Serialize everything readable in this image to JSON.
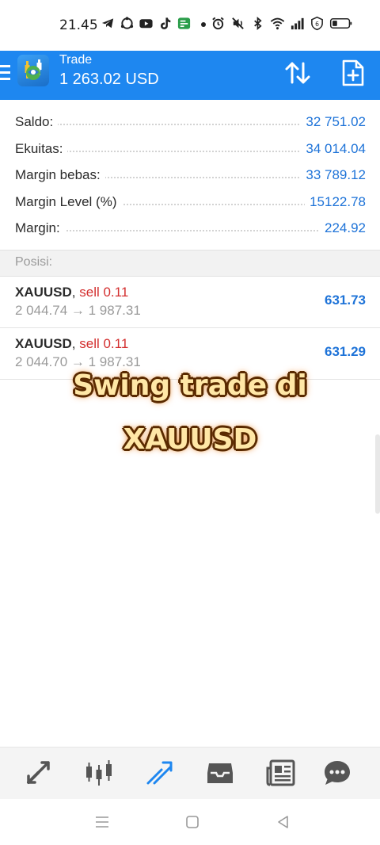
{
  "status_bar": {
    "time": "21.45",
    "left_icons": [
      "telegram-icon",
      "recycle-icon",
      "youtube-icon",
      "tiktok-icon",
      "chat-icon"
    ],
    "right_icons": [
      "alarm-icon",
      "mute-icon",
      "bluetooth-icon",
      "wifi-icon",
      "signal-icon",
      "data-saver-icon",
      "battery-icon"
    ]
  },
  "app_bar": {
    "title": "Trade",
    "balance": "1 263.02 USD",
    "color": "#1e87f0"
  },
  "summary": [
    {
      "label": "Saldo:",
      "value": "32 751.02"
    },
    {
      "label": "Ekuitas:",
      "value": "34 014.04"
    },
    {
      "label": "Margin bebas:",
      "value": "33 789.12"
    },
    {
      "label": "Margin Level (%)",
      "value": "15122.78"
    },
    {
      "label": "Margin:",
      "value": "224.92"
    }
  ],
  "positions_header": "Posisi:",
  "positions": [
    {
      "symbol": "XAUUSD",
      "separator": ", ",
      "type": "sell 0.11",
      "prices": "2 044.74 → 1 987.31",
      "profit": "631.73"
    },
    {
      "symbol": "XAUUSD",
      "separator": ", ",
      "type": "sell 0.11",
      "prices": "2 044.70 → 1 987.31",
      "profit": "631.29"
    }
  ],
  "caption": {
    "line1": "Swing trade di",
    "line2": "XAUUSD"
  },
  "bottom_nav": [
    "quotes-icon",
    "chart-icon",
    "trade-icon",
    "history-icon",
    "news-icon",
    "chat-icon"
  ],
  "active_nav": "trade-icon",
  "colors": {
    "accent": "#1e87f0",
    "value_blue": "#1e73d8",
    "sell_red": "#d32f2f",
    "nav_gray": "#555555"
  }
}
